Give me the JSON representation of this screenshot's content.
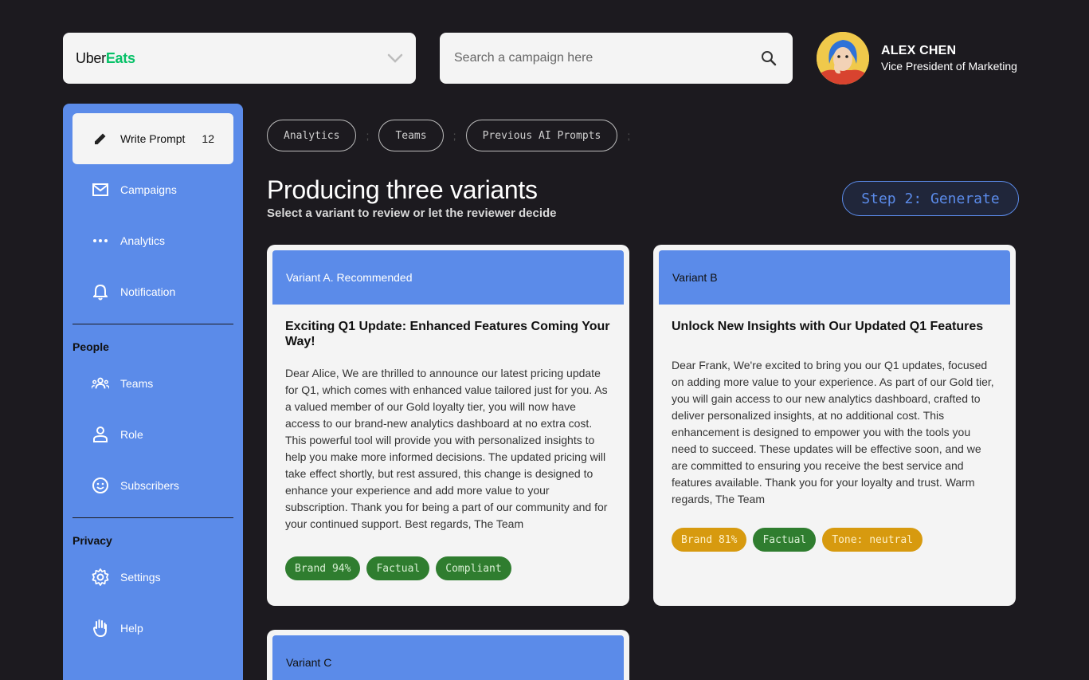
{
  "brand": {
    "part1": "Uber",
    "part2": "Eats",
    "accent": "#06c167"
  },
  "search": {
    "placeholder": "Search a campaign here"
  },
  "profile": {
    "name": "ALEX CHEN",
    "role": "Vice President of Marketing"
  },
  "sidebar": {
    "items": [
      {
        "label": "Write Prompt",
        "count": "12",
        "icon": "pencil-icon"
      },
      {
        "label": "Campaigns",
        "icon": "mail-icon"
      },
      {
        "label": "Analytics",
        "icon": "more-dots-icon"
      },
      {
        "label": "Notification",
        "icon": "bell-icon"
      }
    ],
    "people_title": "People",
    "people": [
      {
        "label": "Teams",
        "icon": "group-icon"
      },
      {
        "label": "Role",
        "icon": "person-icon"
      },
      {
        "label": "Subscribers",
        "icon": "smiley-icon"
      }
    ],
    "privacy_title": "Privacy",
    "privacy": [
      {
        "label": "Settings",
        "icon": "gear-icon"
      },
      {
        "label": "Help",
        "icon": "hand-icon"
      }
    ]
  },
  "filters": [
    "Analytics",
    "Teams",
    "Previous AI Prompts"
  ],
  "filter_sep": ";",
  "header": {
    "title": "Producing three variants",
    "subtitle": "Select a variant to review or let the reviewer decide",
    "step_label": "Step 2: Generate"
  },
  "variants": [
    {
      "label": "Variant A. Recommended",
      "title": "Exciting Q1 Update: Enhanced Features Coming Your Way!",
      "body": "Dear Alice, We are thrilled to announce our latest pricing update for Q1, which comes with enhanced value tailored just for you. As a valued member of our Gold loyalty tier, you will now have access to our brand-new analytics dashboard at no extra cost. This powerful tool will provide you with personalized insights to help you make more informed decisions. The updated pricing will take effect shortly, but rest assured, this change is designed to enhance your experience and add more value to your subscription. Thank you for being a part of our community and for your continued support. Best regards, The Team",
      "tags": [
        "Brand 94%",
        "Factual",
        "Compliant"
      ]
    },
    {
      "label": "Variant B",
      "title": "Unlock New Insights with Our Updated Q1 Features",
      "body": "Dear Frank, We're excited to bring you our Q1 updates, focused on adding more value to your experience. As part of our Gold tier, you will gain access to our new analytics dashboard, crafted to deliver personalized insights, at no additional cost. This enhancement is designed to empower you with the tools you need to succeed. These updates will be effective soon, and we are committed to ensuring you receive the best service and features available. Thank you for your loyalty and trust. Warm regards, The Team",
      "tags": [
        "Brand 81%",
        "Factual",
        "Tone: neutral"
      ]
    },
    {
      "label": "Variant C"
    }
  ],
  "colors": {
    "background": "#1c1a1f",
    "sidebar": "#5b8be9",
    "tag_green": "#2f7d2f",
    "tag_amber": "#d79a0f"
  }
}
